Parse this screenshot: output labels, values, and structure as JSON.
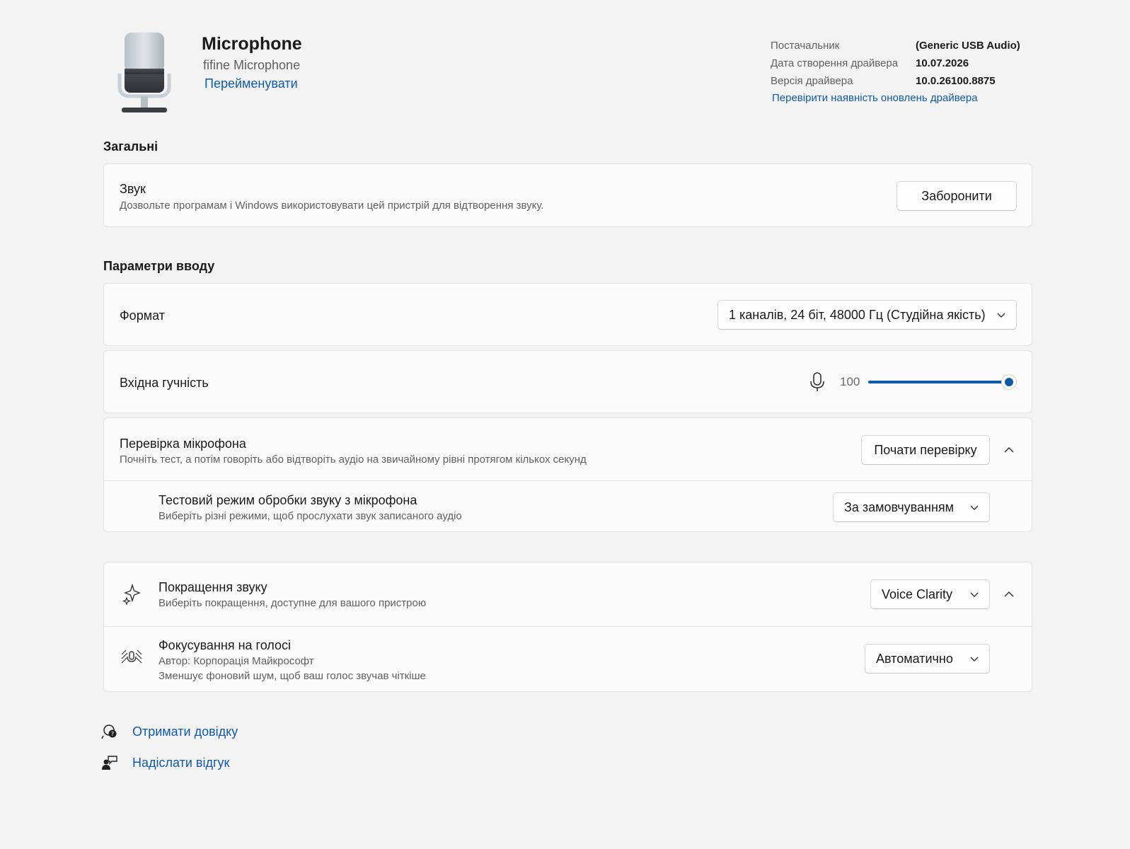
{
  "device": {
    "name": "Microphone",
    "subtitle": "fifine Microphone",
    "rename_link": "Перейменувати"
  },
  "driver": {
    "rows": [
      {
        "label": "Постачальник",
        "value": "(Generic USB Audio)"
      },
      {
        "label": "Дата створення драйвера",
        "value": "10.07.2026"
      },
      {
        "label": "Версія драйвера",
        "value": "10.0.26100.8875"
      }
    ],
    "update_link": "Перевірити наявність оновлень драйвера"
  },
  "general": {
    "section_title": "Загальні",
    "audio_title": "Звук",
    "audio_desc": "Дозвольте програмам і Windows використовувати цей пристрій для відтворення звуку.",
    "disable_button": "Заборонити"
  },
  "input": {
    "section_title": "Параметри вводу",
    "format_label": "Формат",
    "format_value": "1 каналів, 24 біт, 48000 Гц (Студійна якість)",
    "volume_label": "Вхідна гучність",
    "volume_value": "100",
    "volume_level": 1.0,
    "test_title": "Перевірка мікрофона",
    "test_desc": "Почніть тест, а потім говоріть або відтворіть аудіо на звичайному рівні протягом кількох секунд",
    "test_button": "Почати перевірку",
    "test_mode_title": "Тестовий режим обробки звуку з мікрофона",
    "test_mode_desc": "Виберіть різні режими, щоб прослухати звук записаного аудіо",
    "test_mode_value": "За замовчуванням"
  },
  "enhancements": {
    "title": "Покращення звуку",
    "desc": "Виберіть покращення, доступне для вашого пристрою",
    "value": "Voice Clarity",
    "voice_focus_title": "Фокусування на голосі",
    "voice_focus_author": "Автор: Корпорація Майкрософт",
    "voice_focus_desc": "Зменшує фоновий шум, щоб ваш голос звучав чіткіше",
    "voice_focus_value": "Автоматично"
  },
  "footer": {
    "help_link": "Отримати довідку",
    "feedback_link": "Надіслати відгук"
  },
  "colors": {
    "accent": "#0f5aa8",
    "background": "#f3f3f3",
    "card": "#fbfbfb"
  },
  "icons": [
    "microphone-device-image",
    "microphone-icon",
    "chevron-down-icon",
    "chevron-up-icon",
    "sparkle-icon",
    "voice-focus-icon",
    "help-icon",
    "feedback-icon"
  ]
}
